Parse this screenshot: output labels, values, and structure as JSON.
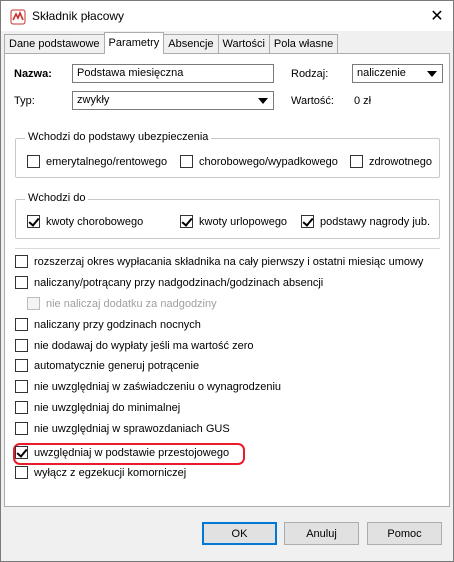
{
  "window": {
    "title": "Składnik płacowy",
    "close_glyph": "✕",
    "icon": "app-icon"
  },
  "tabs": [
    {
      "label": "Dane podstawowe",
      "active": false
    },
    {
      "label": "Parametry",
      "active": true
    },
    {
      "label": "Absencje",
      "active": false
    },
    {
      "label": "Wartości",
      "active": false
    },
    {
      "label": "Pola własne",
      "active": false
    }
  ],
  "form": {
    "name_label": "Nazwa:",
    "name_value": "Podstawa miesięczna",
    "kind_label": "Rodzaj:",
    "kind_value": "naliczenie",
    "type_label": "Typ:",
    "type_value": "zwykły",
    "value_label": "Wartość:",
    "value_value": "0 zł"
  },
  "insurance_group": {
    "title": "Wchodzi do podstawy ubezpieczenia",
    "items": [
      {
        "label": "emerytalnego/rentowego",
        "checked": false
      },
      {
        "label": "chorobowego/wypadkowego",
        "checked": false
      },
      {
        "label": "zdrowotnego",
        "checked": false
      }
    ]
  },
  "includes_group": {
    "title": "Wchodzi do",
    "items": [
      {
        "label": "kwoty chorobowego",
        "checked": true
      },
      {
        "label": "kwoty urlopowego",
        "checked": true
      },
      {
        "label": "podstawy nagrody jub.",
        "checked": true
      }
    ]
  },
  "options": [
    {
      "label": "rozszerzaj okres wypłacania składnika na cały pierwszy i ostatni miesiąc umowy",
      "checked": false,
      "disabled": false
    },
    {
      "label": "naliczany/potrącany przy nadgodzinach/godzinach absencji",
      "checked": false,
      "disabled": false
    },
    {
      "label": "nie naliczaj dodatku za nadgodziny",
      "checked": false,
      "disabled": true
    },
    {
      "label": "naliczany przy godzinach nocnych",
      "checked": false,
      "disabled": false
    },
    {
      "label": "nie dodawaj do wypłaty jeśli ma wartość zero",
      "checked": false,
      "disabled": false
    },
    {
      "label": "automatycznie generuj potrącenie",
      "checked": false,
      "disabled": false
    },
    {
      "label": "nie uwzględniaj w zaświadczeniu o wynagrodzeniu",
      "checked": false,
      "disabled": false
    },
    {
      "label": "nie uwzględniaj do minimalnej",
      "checked": false,
      "disabled": false
    },
    {
      "label": "nie uwzględniaj w sprawozdaniach GUS",
      "checked": false,
      "disabled": false
    },
    {
      "label": "uwzględniaj w podstawie przestojowego",
      "checked": true,
      "disabled": false
    },
    {
      "label": "wyłącz z egzekucji komorniczej",
      "checked": false,
      "disabled": false
    }
  ],
  "buttons": {
    "ok": "OK",
    "cancel": "Anuluj",
    "help": "Pomoc"
  },
  "colors": {
    "highlight": "#e81c2a",
    "default_button_border": "#0078d7"
  }
}
